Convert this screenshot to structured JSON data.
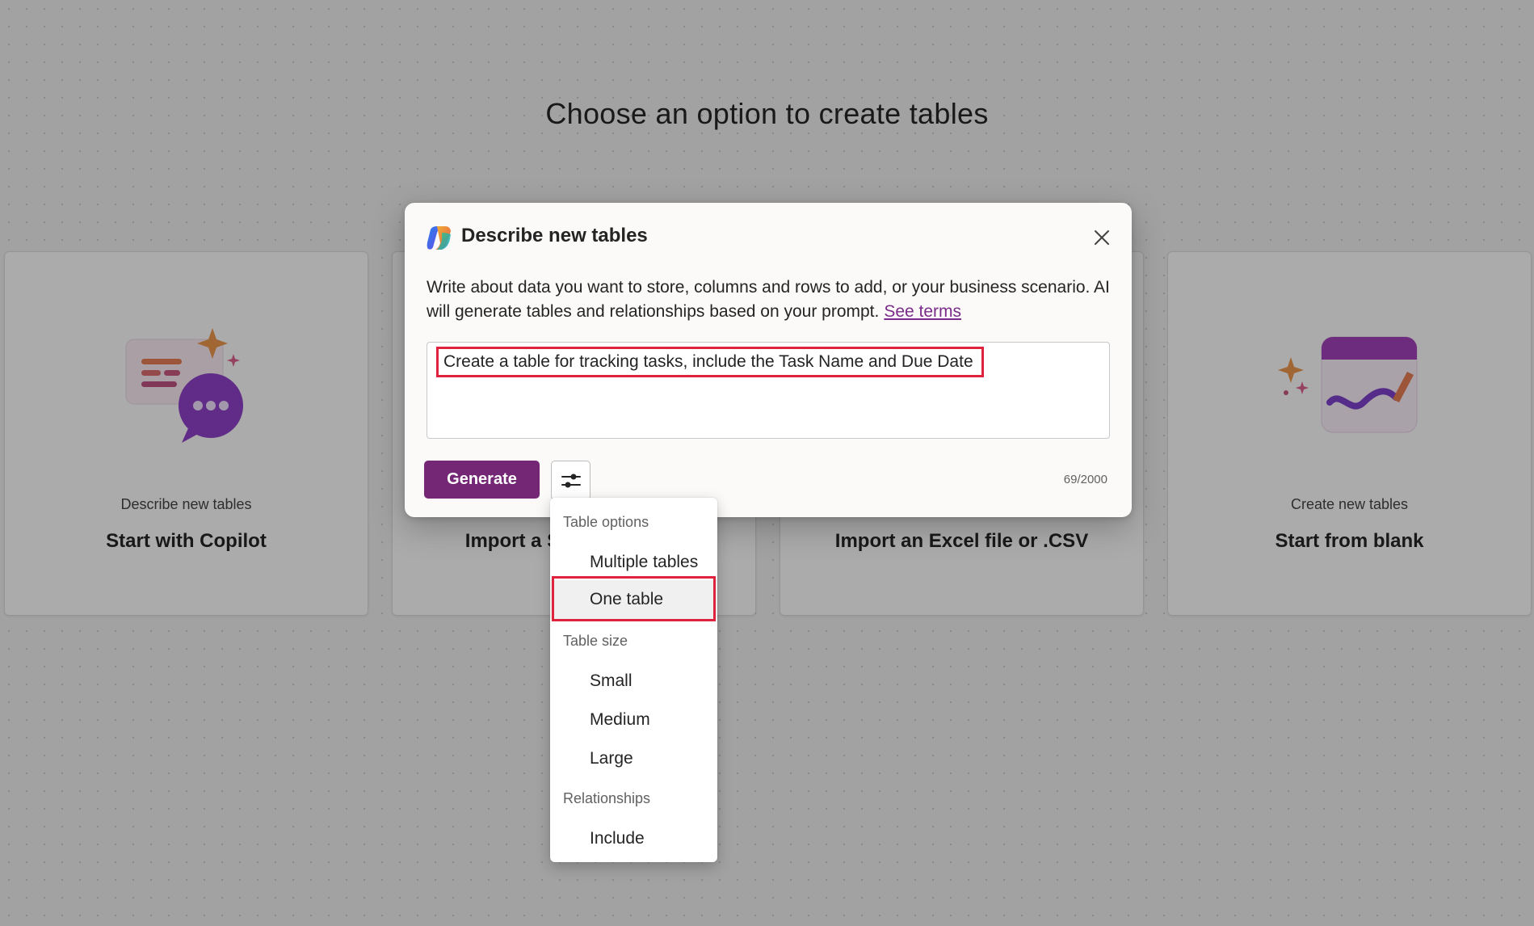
{
  "page": {
    "title": "Choose an option to create tables"
  },
  "cards": [
    {
      "subtitle": "Describe new tables",
      "title": "Start with Copilot",
      "icon": "copilot-chat-illustration"
    },
    {
      "subtitle": "",
      "title": "Import a SharePoint list",
      "icon": "sharepoint-illustration"
    },
    {
      "subtitle": "",
      "title": "Import an Excel file or .CSV",
      "icon": "excel-illustration"
    },
    {
      "subtitle": "Create new tables",
      "title": "Start from blank",
      "icon": "blank-table-illustration"
    }
  ],
  "dialog": {
    "title": "Describe new tables",
    "logo_icon": "copilot-logo-icon",
    "close_icon": "close-icon",
    "description": "Write about data you want to store, columns and rows to add, or your business scenario. AI will generate tables and relationships based on your prompt.",
    "terms_link": "See terms",
    "prompt_value": "Create a table for tracking tasks, include the Task Name and Due Date",
    "generate_label": "Generate",
    "options_icon": "sliders-icon",
    "char_count": "69/2000"
  },
  "menu": {
    "table_options_header": "Table options",
    "table_options": [
      "Multiple tables",
      "One table"
    ],
    "selected_option": "One table",
    "table_size_header": "Table size",
    "table_sizes": [
      "Small",
      "Medium",
      "Large"
    ],
    "relationships_header": "Relationships",
    "relationships": [
      "Include"
    ]
  },
  "colors": {
    "accent": "#742774",
    "highlight": "#e0233d",
    "link": "#7a2c8a"
  }
}
